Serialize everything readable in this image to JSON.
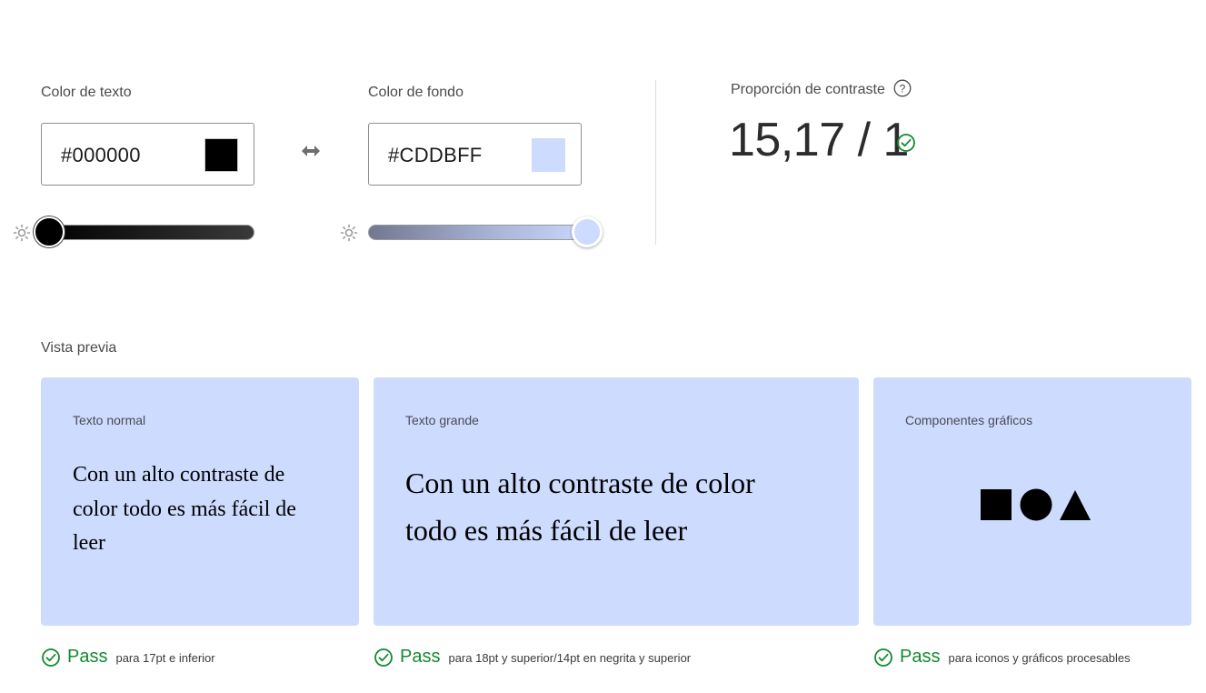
{
  "text_color": {
    "label": "Color de texto",
    "hex": "#000000",
    "swatch": "#000000",
    "lightness": 0
  },
  "bg_color": {
    "label": "Color de fondo",
    "hex": "#CDDBFF",
    "swatch": "#CDDBFF",
    "lightness": 1
  },
  "swap_icon": "swap-arrows-icon",
  "contrast": {
    "label": "Proporción de contraste",
    "ratio": "15,17 / 1",
    "status_icon": "check-circle-icon"
  },
  "preview": {
    "title": "Vista previa",
    "cards": [
      {
        "title": "Texto normal",
        "sample": "Con un alto contraste de color todo es más fácil de leer",
        "pass_label": "Pass",
        "pass_desc": "para 17pt e inferior"
      },
      {
        "title": "Texto grande",
        "sample": "Con un alto contraste de color todo es más fácil de leer",
        "pass_label": "Pass",
        "pass_desc": "para 18pt y superior/14pt en negrita y superior"
      },
      {
        "title": "Componentes gráficos",
        "shapes": [
          "square-icon",
          "circle-icon",
          "triangle-icon"
        ],
        "pass_label": "Pass",
        "pass_desc": "para iconos y gráficos procesables"
      }
    ]
  },
  "colors": {
    "pass_green": "#128a2e",
    "card_bg": "#CDDBFF",
    "text": "#000000"
  }
}
